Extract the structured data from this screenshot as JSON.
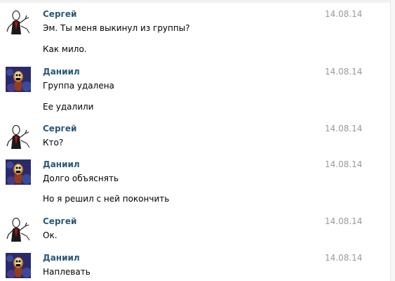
{
  "messages": [
    {
      "author": "Сергей",
      "avatar": "slenderman-avatar",
      "date": "14.08.14",
      "lines": [
        "Эм. Ты меня выкинул из группы?",
        "Как мило."
      ]
    },
    {
      "author": "Даниил",
      "avatar": "skeleton-avatar",
      "date": "14.08.14",
      "lines": [
        "Группа удалена",
        "Ее удалили"
      ]
    },
    {
      "author": "Сергей",
      "avatar": "slenderman-avatar",
      "date": "14.08.14",
      "lines": [
        "Кто?"
      ]
    },
    {
      "author": "Даниил",
      "avatar": "skeleton-avatar",
      "date": "14.08.14",
      "lines": [
        "Долго объяснять",
        "Но я решил с ней покончить"
      ]
    },
    {
      "author": "Сергей",
      "avatar": "slenderman-avatar",
      "date": "14.08.14",
      "lines": [
        "Ок."
      ]
    },
    {
      "author": "Даниил",
      "avatar": "skeleton-avatar",
      "date": "14.08.14",
      "lines": [
        "Наплевать"
      ]
    }
  ],
  "colors": {
    "author": "#2b587a",
    "date": "#999999",
    "text": "#000000"
  }
}
